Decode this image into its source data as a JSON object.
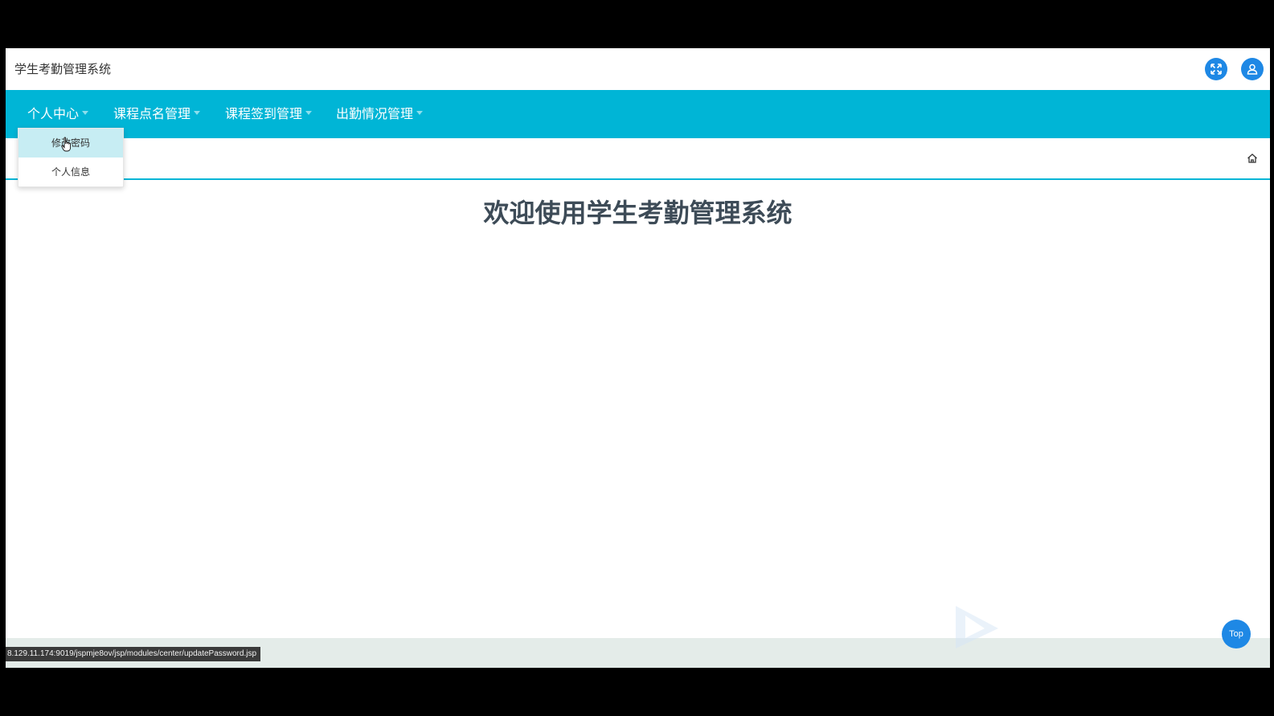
{
  "header": {
    "app_title": "学生考勤管理系统",
    "fullscreen_icon": "fullscreen-icon",
    "user_icon": "user-icon"
  },
  "nav": {
    "items": [
      {
        "label": "个人中心"
      },
      {
        "label": "课程点名管理"
      },
      {
        "label": "课程签到管理"
      },
      {
        "label": "出勤情况管理"
      }
    ],
    "dropdown": {
      "items": [
        {
          "label": "修改密码",
          "active": true
        },
        {
          "label": "个人信息",
          "active": false
        }
      ]
    }
  },
  "main": {
    "welcome": "欢迎使用学生考勤管理系统"
  },
  "footer": {
    "top_label": "Top",
    "status_url": "8.129.11.174:9019/jspmje8ov/jsp/modules/center/updatePassword.jsp"
  },
  "colors": {
    "nav_bg": "#00b5d6",
    "accent_blue": "#1e88e5",
    "welcome_text": "#3d4b57",
    "dropdown_active": "#c7edf3"
  }
}
